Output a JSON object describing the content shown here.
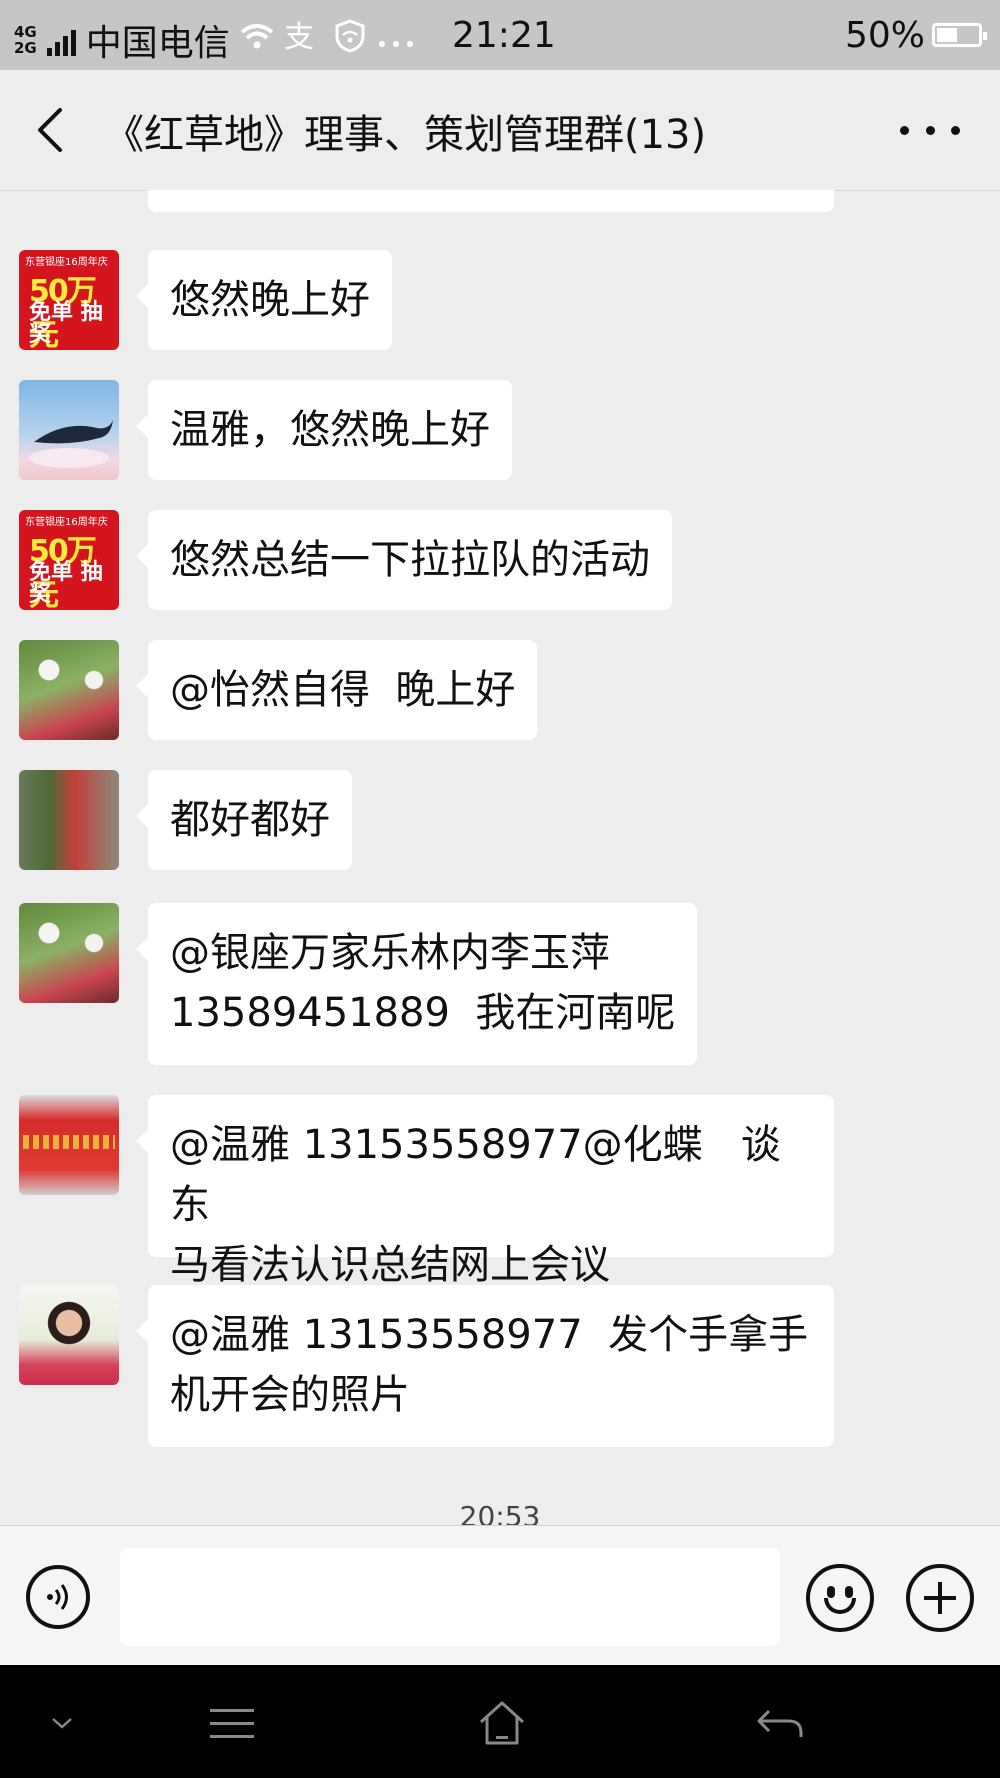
{
  "status_bar": {
    "network_type_top": "4G",
    "network_type_bottom": "2G",
    "carrier": "中国电信",
    "time": "21:21",
    "battery_percent": "50%",
    "battery_level": 0.5,
    "icons": [
      "signal-icon",
      "wifi-icon",
      "alipay-icon",
      "vpn-shield-icon",
      "more-dots-icon"
    ]
  },
  "header": {
    "title": "《红草地》理事、策划管理群(13)"
  },
  "messages": [
    {
      "avatar": "ad-avatar",
      "text": "悠然晚上好"
    },
    {
      "avatar": "sky-whale-avatar",
      "text": "温雅，悠然晚上好"
    },
    {
      "avatar": "ad-avatar",
      "text": "悠然总结一下拉拉队的活动"
    },
    {
      "avatar": "flowers-woman-avatar",
      "text": "@怡然自得  晚上好"
    },
    {
      "avatar": "plant-avatar",
      "text": "都好都好"
    },
    {
      "avatar": "flowers-woman-avatar",
      "text": "@银座万家乐林内李玉萍\n13589451889  我在河南呢"
    },
    {
      "avatar": "red-banner-avatar",
      "text": "@温雅 13153558977@化蝶   谈东\n马看法认识总结网上会议"
    },
    {
      "avatar": "woman-white-flowers-avatar",
      "text": "@温雅 13153558977  发个手拿手\n机开会的照片"
    }
  ],
  "ad_avatar": {
    "top_text": "东营银座16周年庆",
    "big_text": "50万元",
    "small_text": "免单\n抽奖"
  },
  "timestamp": "20:53",
  "input_bar": {
    "placeholder": ""
  },
  "colors": {
    "background": "#ededed",
    "bubble": "#ffffff",
    "status_bar": "#c6c6c6",
    "nav_bar": "#000000"
  }
}
